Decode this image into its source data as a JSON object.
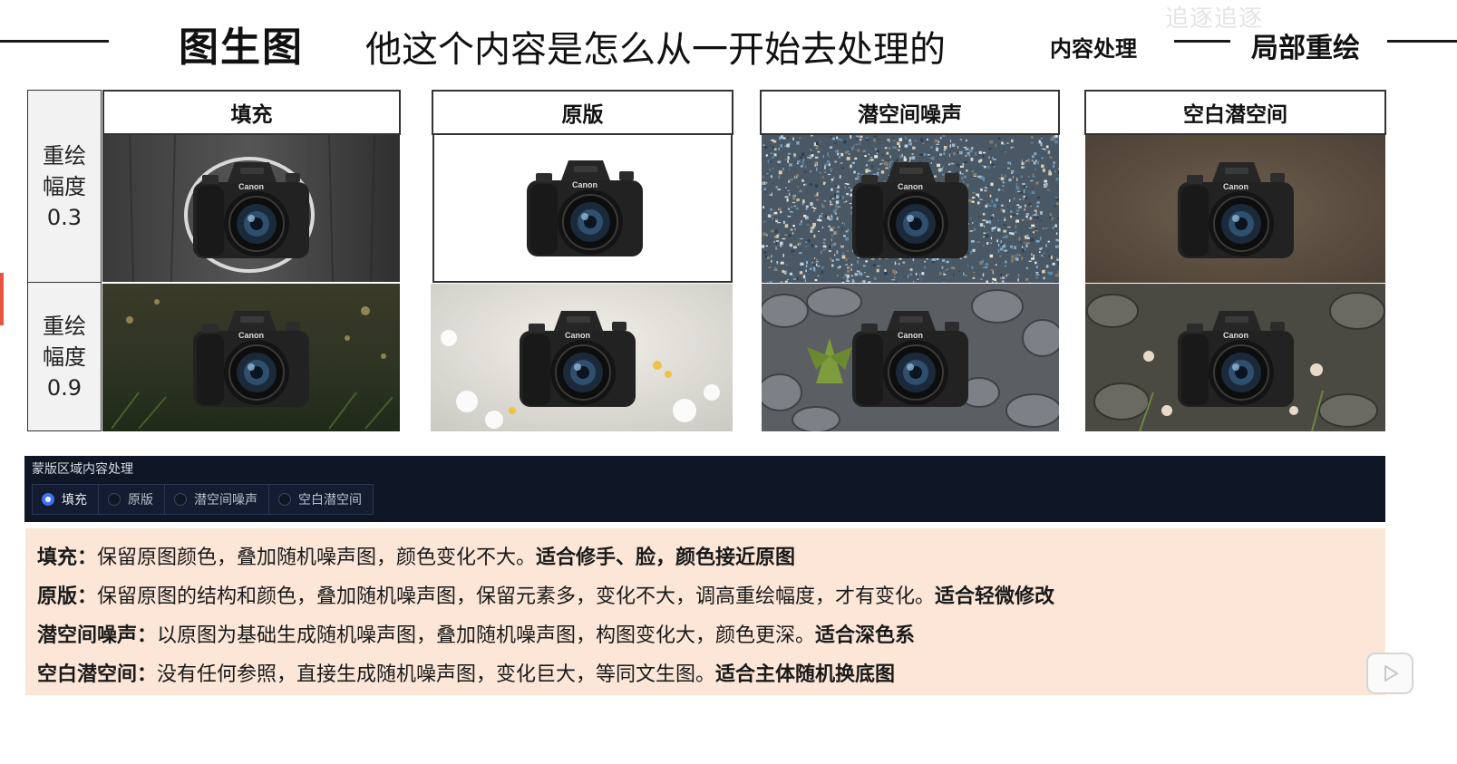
{
  "header": {
    "title_main": "图生图",
    "title_sub": "他这个内容是怎么从一开始去处理的",
    "mask_label": "内容处理",
    "inpaint_label": "局部重绘",
    "watermark": "追逐追逐"
  },
  "grid": {
    "columns": [
      "填充",
      "原版",
      "潜空间噪声",
      "空白潜空间"
    ],
    "rows": [
      {
        "line1": "重绘",
        "line2": "幅度",
        "value": "0.3"
      },
      {
        "line1": "重绘",
        "line2": "幅度",
        "value": "0.9"
      }
    ],
    "camera_brand": "Canon"
  },
  "ui_panel": {
    "title": "蒙版区域内容处理",
    "options": [
      "填充",
      "原版",
      "潜空间噪声",
      "空白潜空间"
    ],
    "selected": "填充"
  },
  "descriptions": [
    {
      "term": "填充：",
      "text": "保留原图颜色，叠加随机噪声图，颜色变化不大。",
      "bold": "适合修手、脸，颜色接近原图"
    },
    {
      "term": "原版：",
      "text": "保留原图的结构和颜色，叠加随机噪声图，保留元素多，变化不大，调高重绘幅度，才有变化。",
      "bold": "适合轻微修改"
    },
    {
      "term": "潜空间噪声：",
      "text": "以原图为基础生成随机噪声图，叠加随机噪声图，构图变化大，颜色更深。",
      "bold": "适合深色系"
    },
    {
      "term": "空白潜空间：",
      "text": "没有任何参照，直接生成随机噪声图，变化巨大，等同文生图。",
      "bold": "适合主体随机换底图"
    }
  ],
  "colors": {
    "panel_bg": "#0f1626",
    "radio_accent": "#3b74f2",
    "desc_bg": "#fbe6d8"
  },
  "icons": [
    "radio-selected-icon",
    "radio-icon",
    "play-icon",
    "camera-icon"
  ]
}
